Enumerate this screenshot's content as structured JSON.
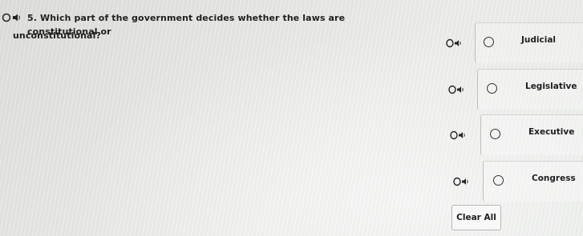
{
  "question": {
    "number": "5.",
    "text_line1": "Which part of the government decides whether the laws are constitutional or",
    "text_line2": "unconstitutional?",
    "audio_icon": "speaker-icon"
  },
  "options": [
    {
      "label": "Judicial",
      "selected": false,
      "audio_icon": "speaker-icon"
    },
    {
      "label": "Legislative",
      "selected": false,
      "audio_icon": "speaker-icon"
    },
    {
      "label": "Executive",
      "selected": false,
      "audio_icon": "speaker-icon"
    },
    {
      "label": "Congress",
      "selected": false,
      "audio_icon": "speaker-icon"
    }
  ],
  "clear_button": {
    "label": "Clear All"
  }
}
